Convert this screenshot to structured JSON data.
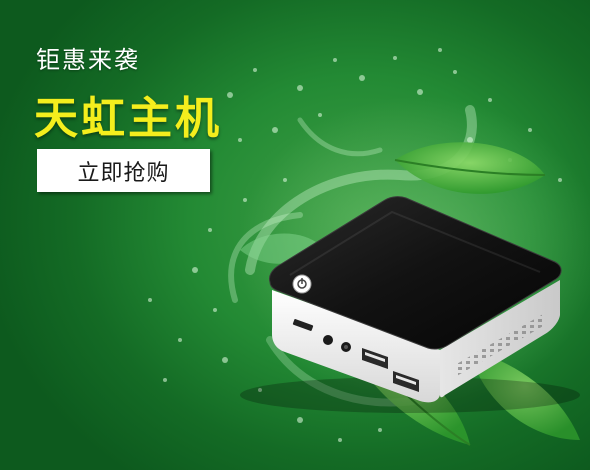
{
  "banner": {
    "tagline": "钜惠来袭",
    "title": "天虹主机",
    "buy_button_label": "立即抢购",
    "colors": {
      "background": "#1e8a30",
      "title": "#f4ee1d",
      "button_background": "#ffffff",
      "device_top": "#151515",
      "device_body": "#f2f2f2"
    },
    "icons": [
      "water-splash",
      "mint-leaf",
      "power-button-icon",
      "usb-port-icon",
      "audio-jack-icon",
      "sd-card-slot-icon"
    ]
  }
}
